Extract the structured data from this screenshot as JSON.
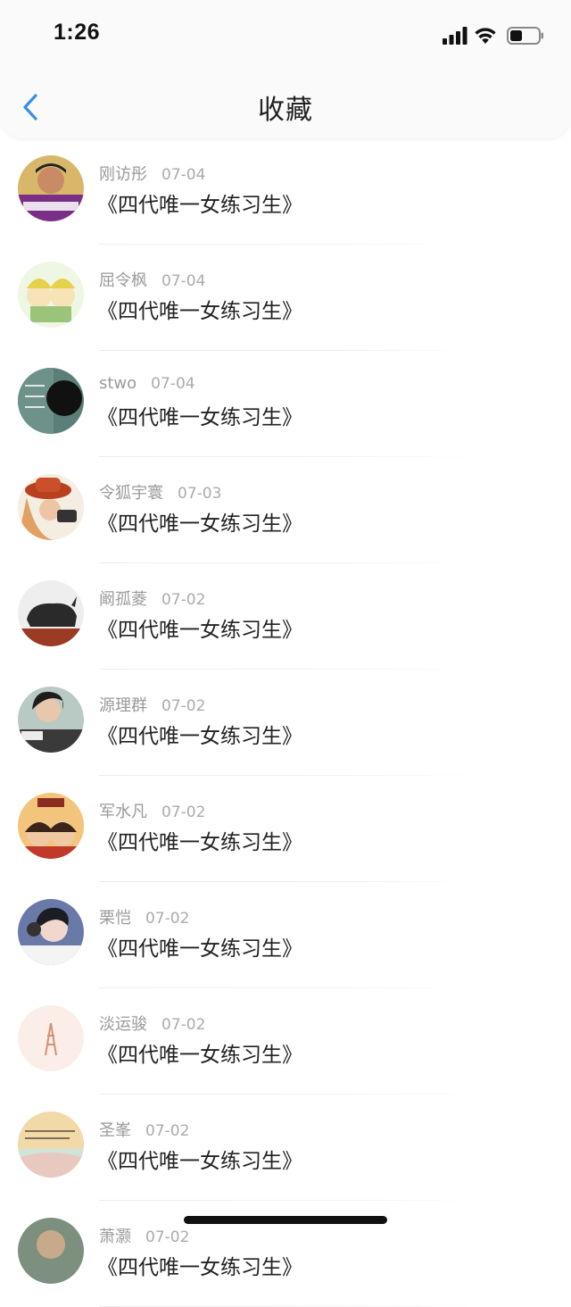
{
  "status_bar": {
    "time": "1:26"
  },
  "nav": {
    "title": "收藏",
    "back_icon": "chevron-left-icon",
    "accent_color": "#3a8ee6"
  },
  "favorites": [
    {
      "name": "刚访彤",
      "date": "07-04",
      "title": "《四代唯一女练习生》"
    },
    {
      "name": "屈令枫",
      "date": "07-04",
      "title": "《四代唯一女练习生》"
    },
    {
      "name": "stwo",
      "date": "07-04",
      "title": "《四代唯一女练习生》"
    },
    {
      "name": "令狐宇寰",
      "date": "07-03",
      "title": "《四代唯一女练习生》"
    },
    {
      "name": "阚孤菱",
      "date": "07-02",
      "title": "《四代唯一女练习生》"
    },
    {
      "name": "源理群",
      "date": "07-02",
      "title": "《四代唯一女练习生》"
    },
    {
      "name": "军水凡",
      "date": "07-02",
      "title": "《四代唯一女练习生》"
    },
    {
      "name": "栗恺",
      "date": "07-02",
      "title": "《四代唯一女练习生》"
    },
    {
      "name": "淡运骏",
      "date": "07-02",
      "title": "《四代唯一女练习生》"
    },
    {
      "name": "圣峯",
      "date": "07-02",
      "title": "《四代唯一女练习生》"
    },
    {
      "name": "萧灏",
      "date": "07-02",
      "title": "《四代唯一女练习生》"
    }
  ]
}
